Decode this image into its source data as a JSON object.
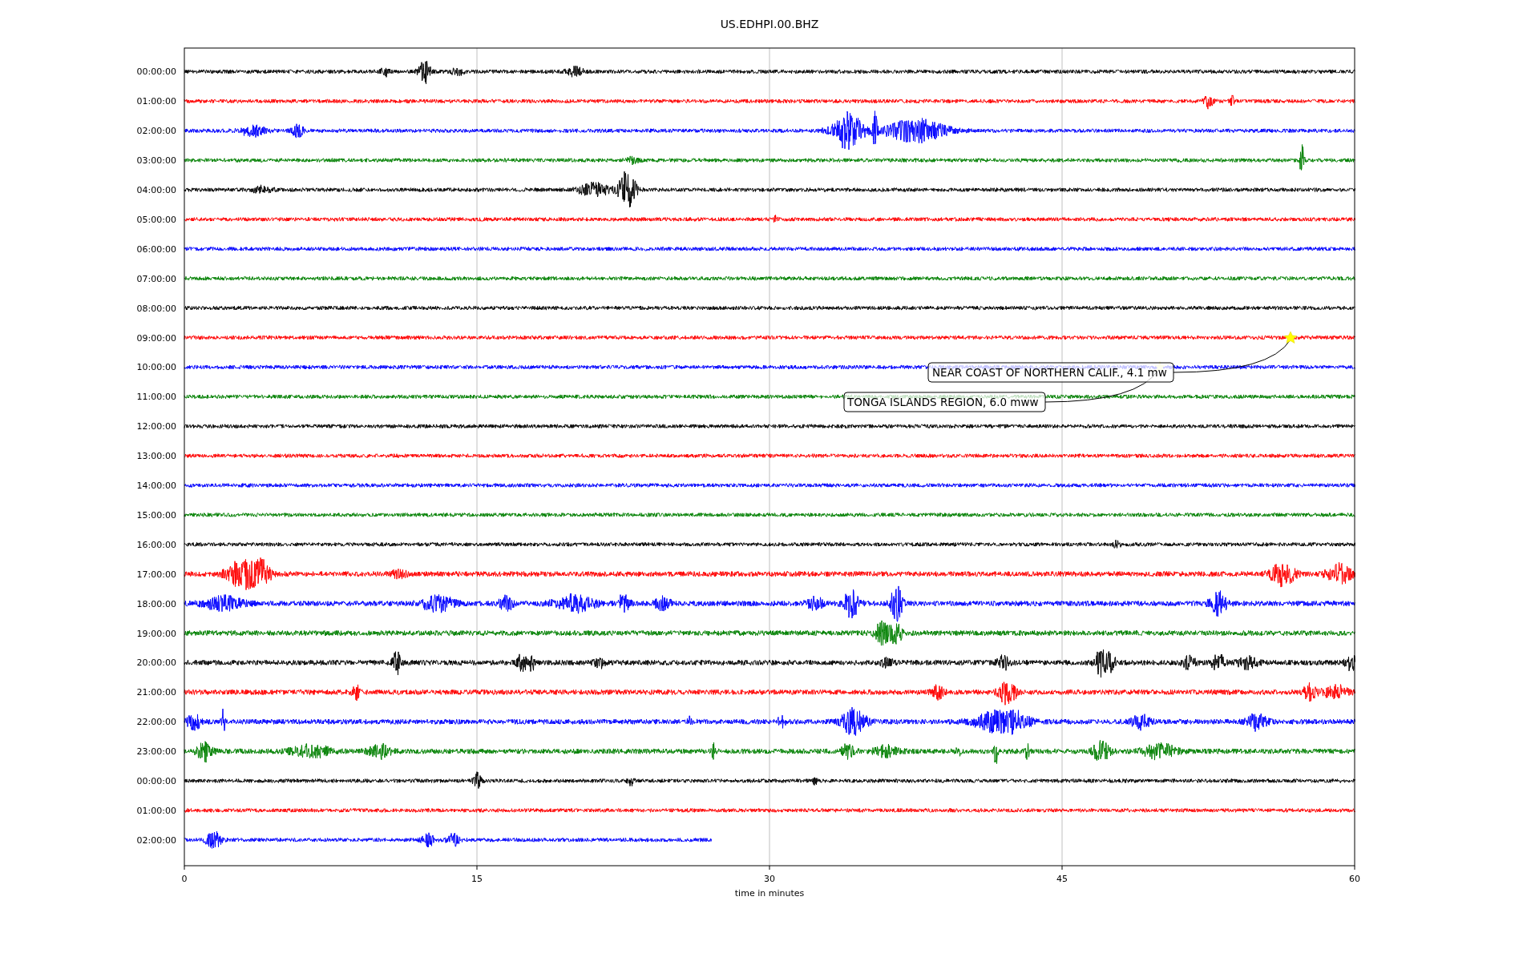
{
  "title": "US.EDHPI.00.BHZ",
  "traces": [
    {
      "label": "00:00:00",
      "color": "#000000",
      "level": 1
    },
    {
      "label": "01:00:00",
      "color": "#ff0000",
      "level": 1
    },
    {
      "label": "02:00:00",
      "color": "#0000ff",
      "level": 1
    },
    {
      "label": "03:00:00",
      "color": "#008000",
      "level": 1
    },
    {
      "label": "04:00:00",
      "color": "#000000",
      "level": 1
    },
    {
      "label": "05:00:00",
      "color": "#ff0000",
      "level": 1
    },
    {
      "label": "06:00:00",
      "color": "#0000ff",
      "level": 1
    },
    {
      "label": "07:00:00",
      "color": "#008000",
      "level": 1
    },
    {
      "label": "08:00:00",
      "color": "#000000",
      "level": 1
    },
    {
      "label": "09:00:00",
      "color": "#ff0000",
      "level": 1
    },
    {
      "label": "10:00:00",
      "color": "#0000ff",
      "level": 1
    },
    {
      "label": "11:00:00",
      "color": "#008000",
      "level": 1
    },
    {
      "label": "12:00:00",
      "color": "#000000",
      "level": 1
    },
    {
      "label": "13:00:00",
      "color": "#ff0000",
      "level": 1
    },
    {
      "label": "14:00:00",
      "color": "#0000ff",
      "level": 1
    },
    {
      "label": "15:00:00",
      "color": "#008000",
      "level": 1
    },
    {
      "label": "16:00:00",
      "color": "#000000",
      "level": 1
    },
    {
      "label": "17:00:00",
      "color": "#ff0000",
      "level": 1
    },
    {
      "label": "18:00:00",
      "color": "#0000ff",
      "level": 1
    },
    {
      "label": "19:00:00",
      "color": "#008000",
      "level": 1
    },
    {
      "label": "20:00:00",
      "color": "#000000",
      "level": 1
    },
    {
      "label": "21:00:00",
      "color": "#ff0000",
      "level": 1
    },
    {
      "label": "22:00:00",
      "color": "#0000ff",
      "level": 1
    },
    {
      "label": "23:00:00",
      "color": "#008000",
      "level": 1
    },
    {
      "label": "00:00:00",
      "color": "#000000",
      "level": 1
    },
    {
      "label": "01:00:00",
      "color": "#ff0000",
      "level": 1
    },
    {
      "label": "02:00:00",
      "color": "#0000ff",
      "level": 0.45
    }
  ],
  "xticks": [
    "0",
    "15",
    "30",
    "45",
    "60"
  ],
  "xlabel": "time in minutes",
  "annotations": [
    {
      "text": "NEAR COAST OF NORTHERN CALIF., 4.1 mw"
    },
    {
      "text": "TONGA ISLANDS REGION, 6.0 mww"
    }
  ]
}
